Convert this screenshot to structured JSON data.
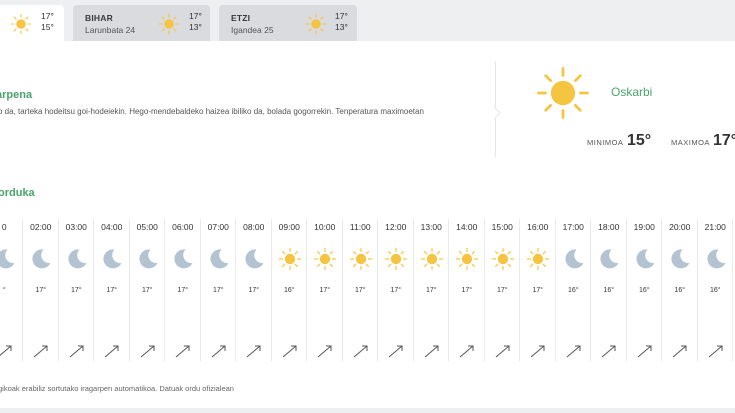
{
  "tabs": [
    {
      "name": "",
      "date": "",
      "max": "17°",
      "min": "15°",
      "icon": "sun-icon",
      "active": true
    },
    {
      "name": "BIHAR",
      "date": "Larunbata 24",
      "max": "17°",
      "min": "13°",
      "icon": "sun-icon",
      "active": false
    },
    {
      "name": "ETZI",
      "date": "Igandea 25",
      "max": "17°",
      "min": "13°",
      "icon": "sun-icon",
      "active": false
    }
  ],
  "summary": {
    "title": "arpena",
    "text": "o da, tarteka hodeitsu goi-hodeiekin. Hego-mendebaldeko haizea ibiliko da, bolada gogorrekin. Tenperatura maximoetan",
    "condition": "Oskarbi",
    "min_label": "MINIMOA",
    "min_value": "15°",
    "max_label": "MAXIMOA",
    "max_value": "17°"
  },
  "hourly": {
    "title": "orduka",
    "items": [
      {
        "time": "0",
        "icon": "moon-icon",
        "temp": "°"
      },
      {
        "time": "02:00",
        "icon": "moon-icon",
        "temp": "17°"
      },
      {
        "time": "03:00",
        "icon": "moon-icon",
        "temp": "17°"
      },
      {
        "time": "04:00",
        "icon": "moon-icon",
        "temp": "17°"
      },
      {
        "time": "05:00",
        "icon": "moon-icon",
        "temp": "17°"
      },
      {
        "time": "06:00",
        "icon": "moon-icon",
        "temp": "17°"
      },
      {
        "time": "07:00",
        "icon": "moon-icon",
        "temp": "17°"
      },
      {
        "time": "08:00",
        "icon": "moon-icon",
        "temp": "17°"
      },
      {
        "time": "09:00",
        "icon": "sun-icon",
        "temp": "16°"
      },
      {
        "time": "10:00",
        "icon": "sun-icon",
        "temp": "17°"
      },
      {
        "time": "11:00",
        "icon": "sun-icon",
        "temp": "17°"
      },
      {
        "time": "12:00",
        "icon": "sun-icon",
        "temp": "17°"
      },
      {
        "time": "13:00",
        "icon": "sun-icon",
        "temp": "17°"
      },
      {
        "time": "14:00",
        "icon": "sun-icon",
        "temp": "17°"
      },
      {
        "time": "15:00",
        "icon": "sun-icon",
        "temp": "17°"
      },
      {
        "time": "16:00",
        "icon": "sun-icon",
        "temp": "17°"
      },
      {
        "time": "17:00",
        "icon": "moon-icon",
        "temp": "16°"
      },
      {
        "time": "18:00",
        "icon": "moon-icon",
        "temp": "16°"
      },
      {
        "time": "19:00",
        "icon": "moon-icon",
        "temp": "16°"
      },
      {
        "time": "20:00",
        "icon": "moon-icon",
        "temp": "16°"
      },
      {
        "time": "21:00",
        "icon": "moon-icon",
        "temp": "16°"
      },
      {
        "time": "2",
        "icon": "moon-icon",
        "temp": ""
      }
    ]
  },
  "footnote": "gikoak erabiliz sortutako iragarpen automatikoa. Datuak ordu ofizialean",
  "colors": {
    "accent": "#4aa36b",
    "sun": "#f5c542",
    "moon": "#b3c3d1"
  }
}
